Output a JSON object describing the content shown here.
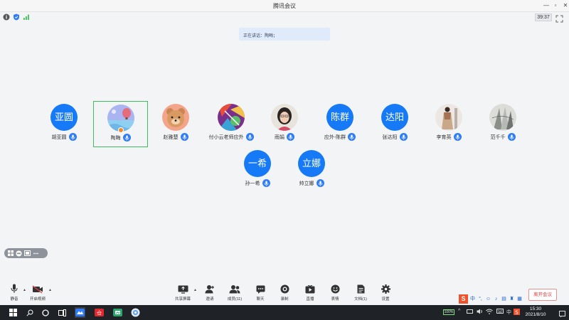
{
  "window": {
    "title": "腾讯会议",
    "timer": "39:37"
  },
  "speaking_banner": "正在讲话：陶晦；",
  "participants": [
    {
      "name": "胡亚圆",
      "avatar_text": "亚圆",
      "avatar": "text",
      "active": false
    },
    {
      "name": "陶晦",
      "avatar_text": "",
      "avatar": "balloon",
      "active": true
    },
    {
      "name": "赵雅楚",
      "avatar_text": "",
      "avatar": "bear",
      "active": false
    },
    {
      "name": "付小云老师应外",
      "avatar_text": "",
      "avatar": "art",
      "active": false
    },
    {
      "name": "雨娟",
      "avatar_text": "",
      "avatar": "photo-woman",
      "active": false
    },
    {
      "name": "应外-陈群",
      "avatar_text": "陈群",
      "avatar": "text",
      "active": false
    },
    {
      "name": "张达阳",
      "avatar_text": "达阳",
      "avatar": "text",
      "active": false
    },
    {
      "name": "李育英",
      "avatar_text": "",
      "avatar": "photo-dress",
      "active": false
    },
    {
      "name": "范千千",
      "avatar_text": "",
      "avatar": "photo-sketch",
      "active": false
    },
    {
      "name": "孙一希",
      "avatar_text": "一希",
      "avatar": "text",
      "active": false
    },
    {
      "name": "帅立娜",
      "avatar_text": "立娜",
      "avatar": "text",
      "active": false
    }
  ],
  "toolbar": {
    "mute": "静音",
    "video": "开启视频",
    "share": "共享屏幕",
    "invite": "邀请",
    "members": "成员(11)",
    "chat": "聊天",
    "record": "录制",
    "live": "直播",
    "reactions": "表情",
    "docs": "文档(1)",
    "settings": "设置",
    "leave": "离开会议"
  },
  "ime": {
    "logo": "S",
    "lang": "中"
  },
  "taskbar": {
    "battery": "100%",
    "time": "15:30",
    "date": "2021/8/10",
    "lang": "中"
  },
  "colors": {
    "accent": "#1679f6",
    "active_border": "#3cbf5c",
    "leave": "#e04040"
  }
}
